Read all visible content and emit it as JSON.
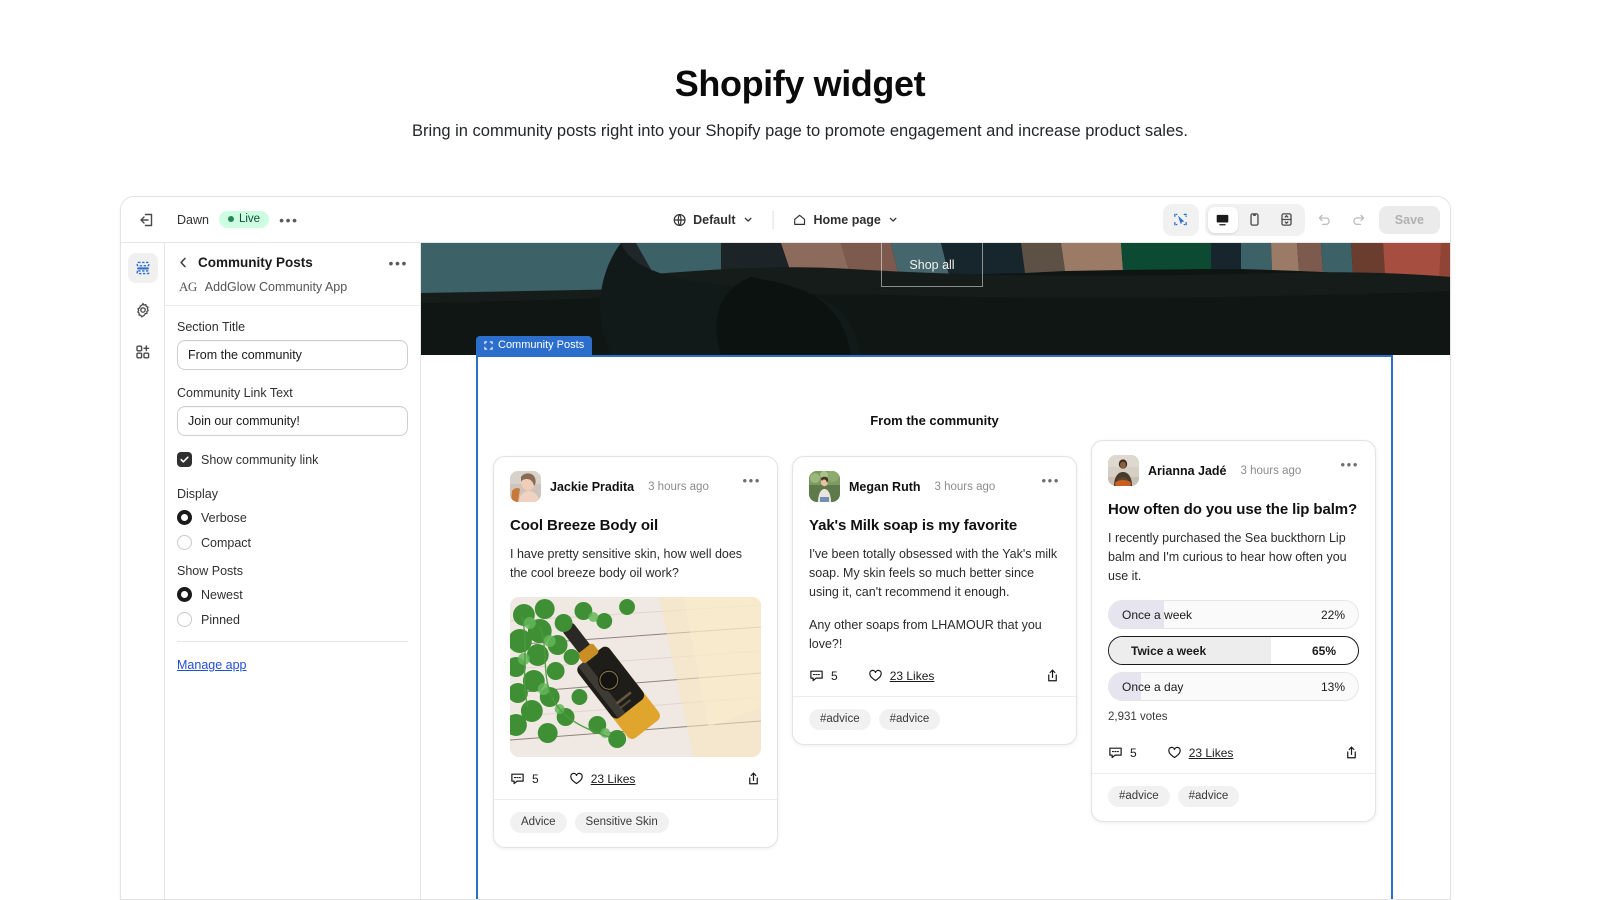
{
  "page": {
    "title": "Shopify widget",
    "subtitle": "Bring in community posts right into your Shopify page to promote engagement and increase product sales."
  },
  "topbar": {
    "exit_icon": "exit-icon",
    "theme_name": "Dawn",
    "status_badge": "Live",
    "more_label": "•••",
    "locale_icon": "globe-icon",
    "locale_label": "Default",
    "page_icon": "home-icon",
    "page_label": "Home page",
    "view_modes": [
      {
        "name": "select-mode",
        "icon": "cursor-select-icon",
        "active": true
      },
      {
        "name": "desktop-view",
        "icon": "desktop-icon",
        "active": true
      },
      {
        "name": "mobile-view",
        "icon": "mobile-icon",
        "active": false
      },
      {
        "name": "fullscreen-view",
        "icon": "fullscreen-icon",
        "active": false
      }
    ],
    "undo_icon": "undo-icon",
    "redo_icon": "redo-icon",
    "save_label": "Save"
  },
  "rail": [
    {
      "name": "sections-icon",
      "active": true
    },
    {
      "name": "gear-icon",
      "active": false
    },
    {
      "name": "app-blocks-add-icon",
      "active": false
    }
  ],
  "panel": {
    "back_icon": "chevron-left-icon",
    "title": "Community Posts",
    "more_label": "•••",
    "app_logo": "AG",
    "app_name": "AddGlow Community App",
    "fields": [
      {
        "label": "Section Title",
        "value": "From the community",
        "name": "section-title-input"
      },
      {
        "label": "Community Link Text",
        "value": "Join our community!",
        "name": "community-link-text-input"
      }
    ],
    "checkbox": {
      "label": "Show community link",
      "checked": true
    },
    "display": {
      "label": "Display",
      "options": [
        {
          "label": "Verbose",
          "selected": true
        },
        {
          "label": "Compact",
          "selected": false
        }
      ]
    },
    "show_posts": {
      "label": "Show Posts",
      "options": [
        {
          "label": "Newest",
          "selected": true
        },
        {
          "label": "Pinned",
          "selected": false
        }
      ]
    },
    "manage_link": "Manage app"
  },
  "preview": {
    "banner": {
      "shop_all_label": "Shop all",
      "section_tag": "Community Posts",
      "section_tag_icon": "section-frame-icon"
    },
    "section_heading": "From the community",
    "cards": [
      {
        "author": "Jackie Pradita",
        "time": "3 hours ago",
        "more": "•••",
        "title": "Cool Breeze Body oil",
        "body": "I have pretty sensitive skin, how well does the cool breeze body oil work?",
        "has_photo": true,
        "photo_alt": "body-oil-bottle-with-plant",
        "comments": "5",
        "likes": "23 Likes",
        "tags": [
          "Advice",
          "Sensitive Skin"
        ]
      },
      {
        "author": "Megan Ruth",
        "time": "3 hours ago",
        "more": "•••",
        "title": "Yak's Milk soap is my favorite",
        "body": "I've been totally obsessed with the Yak's milk soap. My skin feels so much better since using it, can't recommend it enough.",
        "body2": "Any other soaps from LHAMOUR that you love?!",
        "has_photo": false,
        "comments": "5",
        "likes": "23 Likes",
        "tags": [
          "#advice",
          "#advice"
        ]
      },
      {
        "author": "Arianna Jadé",
        "time": "3 hours ago",
        "more": "•••",
        "title": "How often do you use the lip balm?",
        "body": "I recently purchased the Sea buckthorn Lip balm and I'm curious to hear how often you use it.",
        "has_photo": false,
        "poll": {
          "options": [
            {
              "label": "Once a week",
              "pct": "22%",
              "value": 22,
              "selected": false
            },
            {
              "label": "Twice a week",
              "pct": "65%",
              "value": 65,
              "selected": true
            },
            {
              "label": "Once a day",
              "pct": "13%",
              "value": 13,
              "selected": false
            }
          ],
          "votes": "2,931 votes"
        },
        "comments": "5",
        "likes": "23 Likes",
        "tags": [
          "#advice",
          "#advice"
        ]
      }
    ],
    "icons": {
      "comment": "comment-icon",
      "like": "heart-icon",
      "share": "share-icon"
    }
  },
  "colors": {
    "accent_blue": "#2c6ecb",
    "live_green_bg": "#cdfee1",
    "live_green_text": "#0c5132",
    "poll_fill": "#e6e4ef",
    "link_blue": "#2250d6"
  }
}
